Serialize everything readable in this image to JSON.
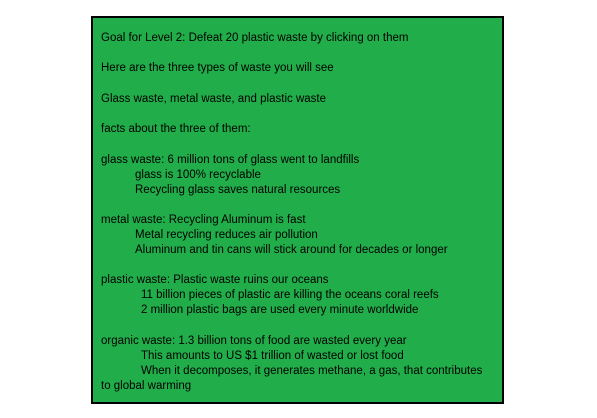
{
  "colors": {
    "panel_background": "#21ad49",
    "panel_border": "#000000",
    "text": "#000000",
    "page_background": "#ffffff"
  },
  "goal": "Goal for Level 2: Defeat 20 plastic waste by clicking on them",
  "intro": "Here are the three types of waste you will see",
  "types": "Glass waste, metal waste, and plastic waste",
  "facts_heading": "facts about the three of them:",
  "glass": {
    "title": "glass waste: 6 million tons of glass went to landfills",
    "facts": [
      "glass is 100% recyclable",
      "Recycling glass saves natural resources"
    ]
  },
  "metal": {
    "title": "metal waste: Recycling Aluminum is fast",
    "facts": [
      "Metal recycling reduces air pollution",
      "Aluminum and tin cans will stick around for decades or longer"
    ]
  },
  "plastic": {
    "title": "plastic waste: Plastic waste ruins our oceans",
    "facts": [
      "11 billion pieces of plastic are killing the oceans coral reefs",
      "2 million plastic bags are used every minute worldwide"
    ]
  },
  "organic": {
    "title": "organic waste: 1.3 billion tons of food are wasted every year",
    "facts": [
      "This amounts to US $1 trillion of wasted or lost food",
      "When it decomposes, it generates methane, a gas, that contributes"
    ],
    "continuation": "to global warming"
  }
}
